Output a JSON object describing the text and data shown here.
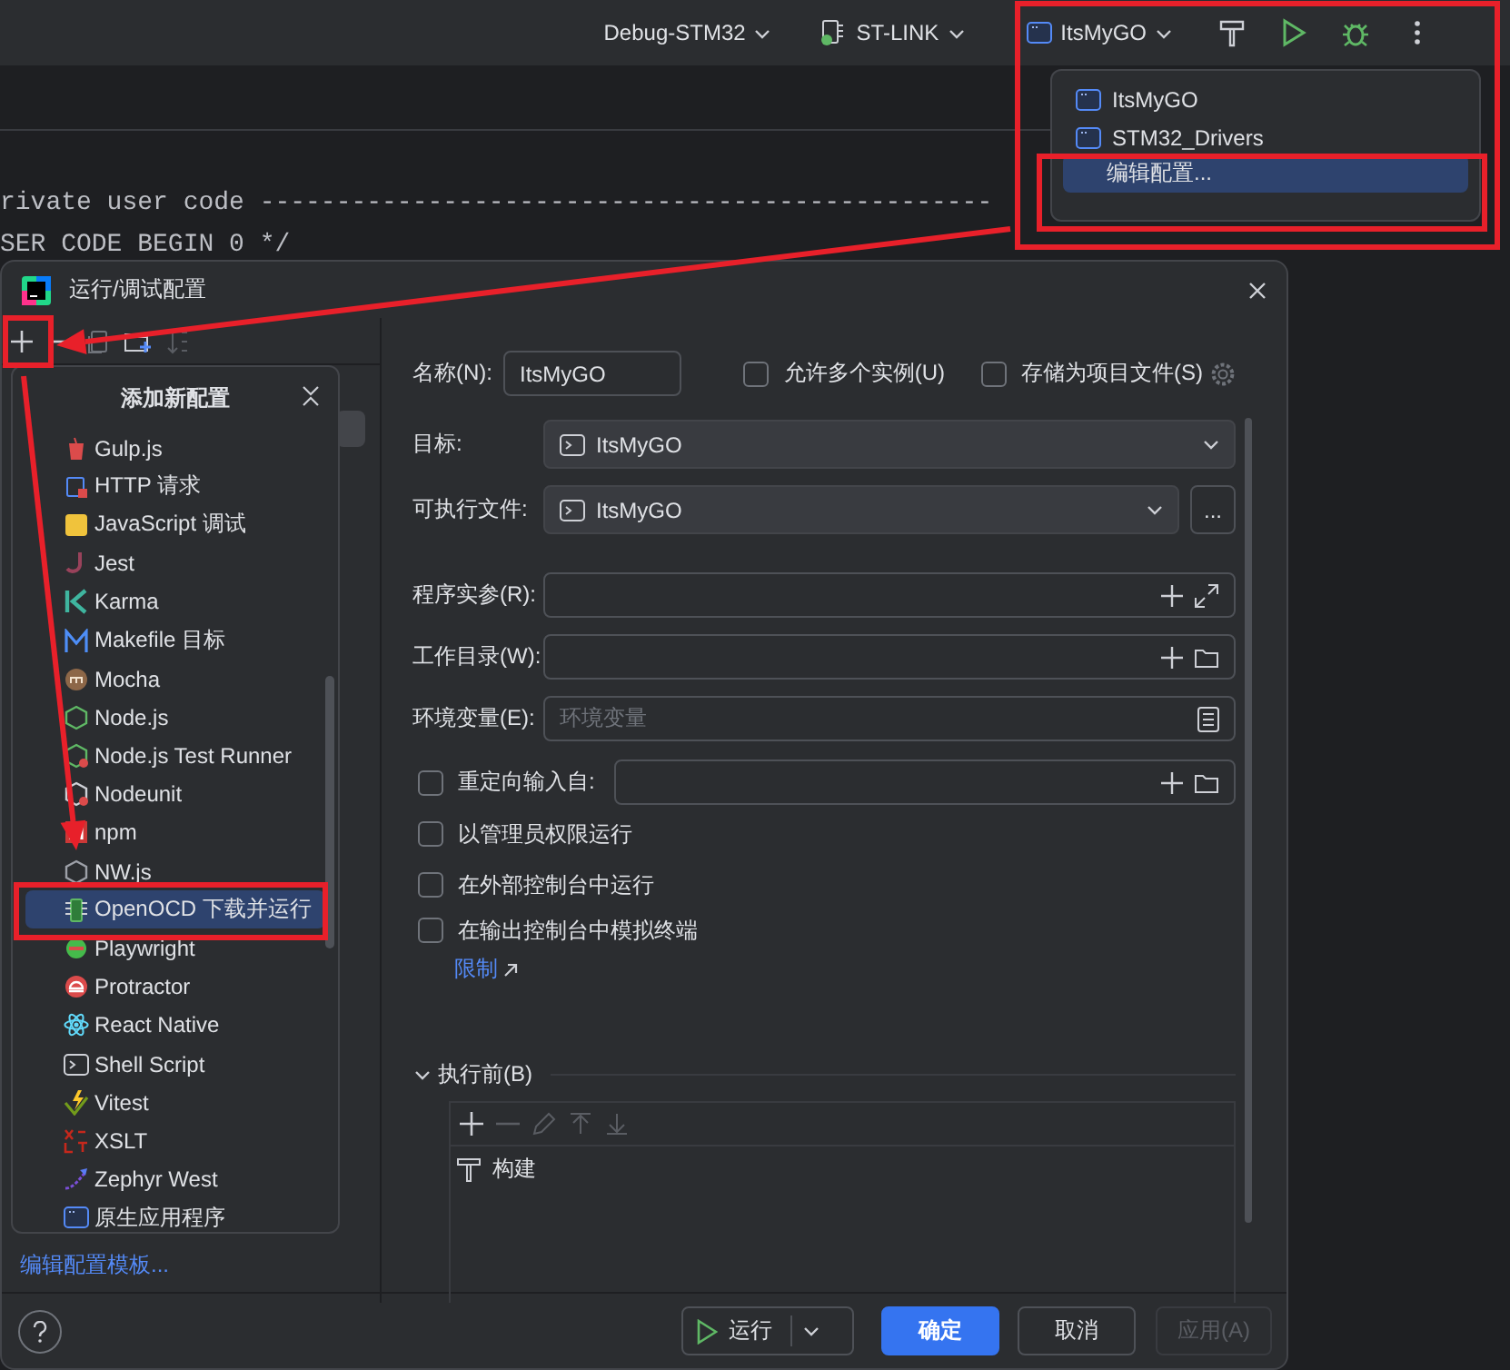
{
  "toolbar": {
    "selectors": [
      {
        "kind": "plain",
        "label": "Debug-STM32"
      },
      {
        "kind": "device",
        "label": "ST-LINK"
      },
      {
        "kind": "app",
        "label": "ItsMyGO"
      }
    ]
  },
  "run_menu": {
    "items": [
      {
        "kind": "app",
        "label": "ItsMyGO",
        "selected": false
      },
      {
        "kind": "app",
        "label": "STM32_Drivers",
        "selected": false
      },
      {
        "kind": "action",
        "label": "编辑配置...",
        "selected": true
      }
    ]
  },
  "editor": {
    "lines": [
      "rivate user code ------------------------------------------------",
      "SER CODE BEGIN 0 */"
    ]
  },
  "dialog": {
    "title": "运行/调试配置",
    "add_popup": {
      "title": "添加新配置",
      "items": [
        {
          "label": "Gulp.js",
          "selected": false
        },
        {
          "label": "HTTP 请求",
          "selected": false
        },
        {
          "label": "JavaScript 调试",
          "selected": false
        },
        {
          "label": "Jest",
          "selected": false
        },
        {
          "label": "Karma",
          "selected": false
        },
        {
          "label": "Makefile 目标",
          "selected": false
        },
        {
          "label": "Mocha",
          "selected": false
        },
        {
          "label": "Node.js",
          "selected": false
        },
        {
          "label": "Node.js Test Runner",
          "selected": false
        },
        {
          "label": "Nodeunit",
          "selected": false
        },
        {
          "label": "npm",
          "selected": false
        },
        {
          "label": "NW.js",
          "selected": false
        },
        {
          "label": "OpenOCD 下载并运行",
          "selected": true
        },
        {
          "label": "Playwright",
          "selected": false
        },
        {
          "label": "Protractor",
          "selected": false
        },
        {
          "label": "React Native",
          "selected": false
        },
        {
          "label": "Shell Script",
          "selected": false
        },
        {
          "label": "Vitest",
          "selected": false
        },
        {
          "label": "XSLT",
          "selected": false
        },
        {
          "label": "Zephyr West",
          "selected": false
        },
        {
          "label": "原生应用程序",
          "selected": false
        }
      ]
    },
    "templates_link": "编辑配置模板...",
    "form": {
      "name_label": "名称(N):",
      "name_value": "ItsMyGO",
      "options": [
        {
          "label": "允许多个实例(U)",
          "checked": false
        },
        {
          "label": "存储为项目文件(S)",
          "checked": false
        }
      ],
      "fields": [
        {
          "kind": "select",
          "label": "目标:",
          "value": "ItsMyGO"
        },
        {
          "kind": "select_browse",
          "label": "可执行文件:",
          "value": "ItsMyGO",
          "button": "..."
        },
        {
          "kind": "text_expand",
          "label": "程序实参(R):"
        },
        {
          "kind": "text_folder",
          "label": "工作目录(W):"
        },
        {
          "kind": "text_doc",
          "label": "环境变量(E):",
          "placeholder": "环境变量"
        }
      ],
      "redirect": {
        "label": "重定向输入自:",
        "checked": false
      },
      "checkboxes": [
        {
          "label": "以管理员权限运行",
          "checked": false
        },
        {
          "label": "在外部控制台中运行",
          "checked": false
        },
        {
          "label": "在输出控制台中模拟终端",
          "checked": false
        }
      ],
      "limits_link": "限制",
      "before_launch": {
        "label": "执行前(B)",
        "expanded": true,
        "tasks": [
          {
            "label": "构建"
          }
        ]
      }
    },
    "footer": {
      "run": "运行",
      "ok": "确定",
      "cancel": "取消",
      "apply": {
        "label": "应用(A)",
        "disabled": true
      }
    }
  }
}
